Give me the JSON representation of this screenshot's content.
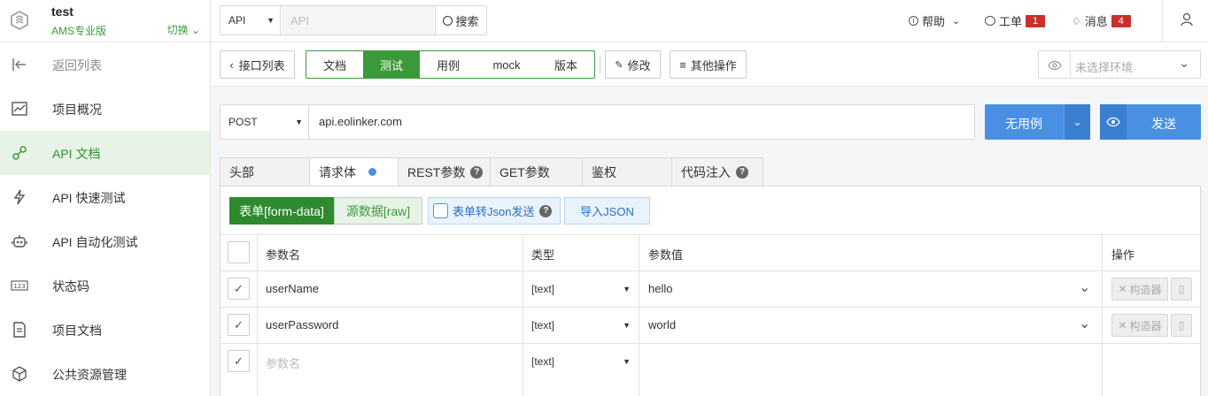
{
  "brand": {
    "name": "test",
    "version": "AMS专业版",
    "switch": "切换"
  },
  "sidebar": {
    "items": [
      {
        "label": "返回列表",
        "icon": "back-arrow-icon"
      },
      {
        "label": "项目概况",
        "icon": "chart-icon"
      },
      {
        "label": "API 文档",
        "icon": "api-doc-icon"
      },
      {
        "label": "API 快速测试",
        "icon": "lightning-icon"
      },
      {
        "label": "API 自动化测试",
        "icon": "robot-icon"
      },
      {
        "label": "状态码",
        "icon": "status-code-icon"
      },
      {
        "label": "项目文档",
        "icon": "document-icon"
      },
      {
        "label": "公共资源管理",
        "icon": "cube-icon"
      }
    ]
  },
  "topbar": {
    "search_type": "API",
    "search_placeholder": "API",
    "search_button": "搜索",
    "help": "帮助",
    "ticket": "工单",
    "ticket_count": "1",
    "message": "消息",
    "message_count": "4"
  },
  "toolbar": {
    "back": "接口列表",
    "tabs": [
      "文档",
      "测试",
      "用例",
      "mock",
      "版本"
    ],
    "edit": "修改",
    "more": "其他操作",
    "env_placeholder": "未选择环境"
  },
  "request": {
    "method": "POST",
    "url": "api.eolinker.com",
    "case_button": "无用例",
    "send_button": "发送"
  },
  "param_tabs": [
    "头部",
    "请求体",
    "REST参数",
    "GET参数",
    "鉴权",
    "代码注入"
  ],
  "body_modes": {
    "form": "表单[form-data]",
    "raw": "源数据[raw]",
    "json_toggle": "表单转Json发送",
    "import": "导入JSON"
  },
  "table": {
    "headers": [
      "参数名",
      "类型",
      "参数值",
      "操作"
    ],
    "rows": [
      {
        "name": "userName",
        "type": "[text]",
        "value": "hello"
      },
      {
        "name": "userPassword",
        "type": "[text]",
        "value": "world"
      },
      {
        "name": "",
        "name_placeholder": "参数名",
        "type": "[text]",
        "value": ""
      }
    ],
    "builder": "构造器"
  },
  "colors": {
    "green": "#3a9a3a",
    "blue": "#4a90e2",
    "red": "#c9302c"
  }
}
